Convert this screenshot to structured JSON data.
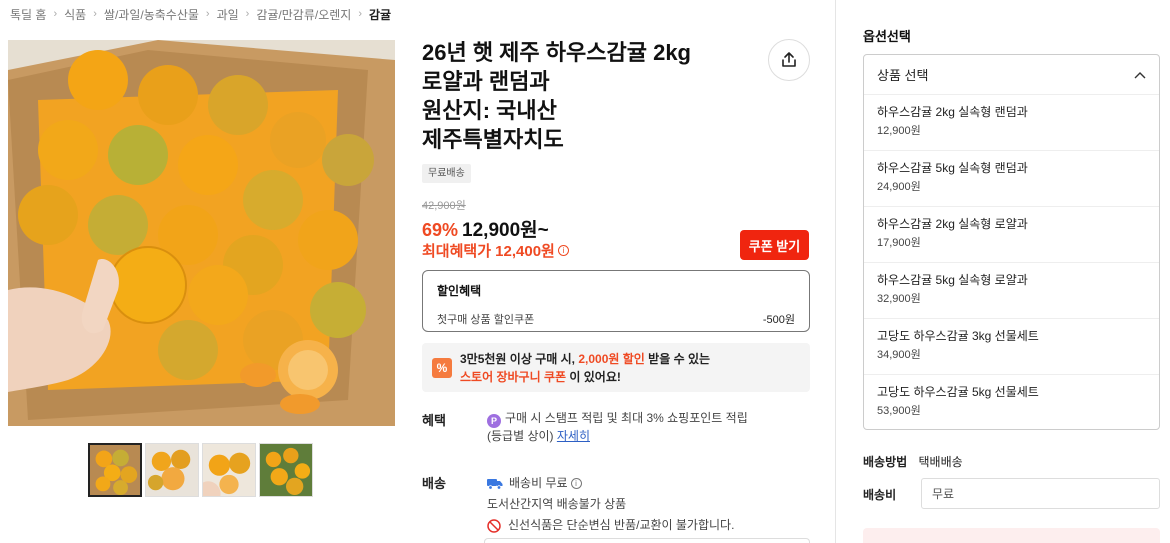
{
  "breadcrumb": {
    "items": [
      "톡딜 홈",
      "식품",
      "쌀/과일/농축수산물",
      "과일",
      "감귤/만감류/오렌지"
    ],
    "current": "감귤"
  },
  "product": {
    "title_lines": [
      "26년 햇 제주 하우스감귤 2kg",
      "로얄과 랜덤과",
      "원산지: 국내산",
      "제주특별자치도"
    ],
    "badge": "무료배송",
    "original_price": "42,900원",
    "discount_percent": "69%",
    "sale_price": "12,900원~",
    "max_benefit_price": "최대혜택가 12,400원",
    "coupon_button": "쿠폰 받기"
  },
  "discount_box": {
    "heading": "할인혜택",
    "row_label": "첫구매 상품 할인쿠폰",
    "row_amount": "-500원"
  },
  "promo": {
    "icon_text": "%",
    "line1_a": "3만5천원 이상 구매 시, ",
    "line1_red": "2,000원 할인",
    "line1_b": " 받을 수 있는",
    "line2_red": "스토어 장바구니 쿠폰",
    "line2_b": "이 있어요!"
  },
  "benefit": {
    "label": "혜택",
    "icon_text": "P",
    "line1": "구매 시 스탬프 적립 및 최대 3% 쇼핑포인트 적립",
    "line2": "(등급별 상이)",
    "link": "자세히"
  },
  "shipping": {
    "label": "배송",
    "fee_text": "배송비 무료",
    "restriction": "도서산간지역 배송불가 상품",
    "notice": "신선식품은 단순변심 반품/교환이 불가합니다."
  },
  "options": {
    "title": "옵션선택",
    "select_label": "상품 선택",
    "items": [
      {
        "name": "하우스감귤 2kg 실속형 랜덤과",
        "price": "12,900원"
      },
      {
        "name": "하우스감귤 5kg 실속형 랜덤과",
        "price": "24,900원"
      },
      {
        "name": "하우스감귤 2kg 실속형 로얄과",
        "price": "17,900원"
      },
      {
        "name": "하우스감귤 5kg 실속형 로얄과",
        "price": "32,900원"
      },
      {
        "name": "고당도 하우스감귤 3kg 선물세트",
        "price": "34,900원"
      },
      {
        "name": "고당도 하우스감귤 5kg 선물세트",
        "price": "53,900원"
      }
    ]
  },
  "delivery": {
    "method_label": "배송방법",
    "method_value": "택배배송",
    "fee_label": "배송비",
    "fee_value": "무료"
  },
  "colors": {
    "accent_red": "#ef4a23",
    "coupon_button": "#f0250f",
    "link_blue": "#2d5fc4",
    "point_purple": "#9e6fe0"
  },
  "icons": [
    "share-icon",
    "chevron-up-icon",
    "info-icon",
    "truck-icon",
    "no-entry-icon",
    "point-icon",
    "percent-icon"
  ]
}
